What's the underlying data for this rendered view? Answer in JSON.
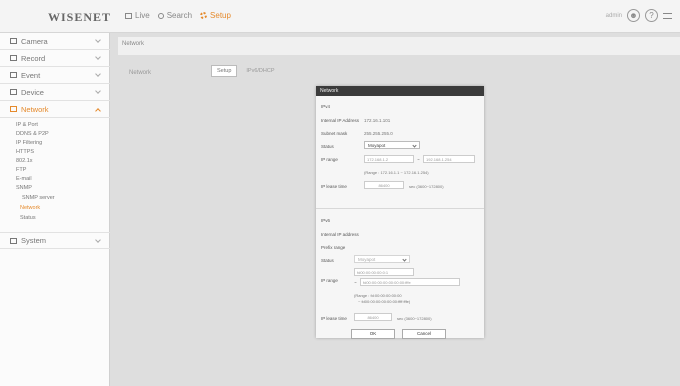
{
  "header": {
    "logo": "WISENET",
    "nav": [
      {
        "label": "Live",
        "icon": "monitor-icon"
      },
      {
        "label": "Search",
        "icon": "search-icon"
      },
      {
        "label": "Setup",
        "icon": "gear-icon"
      }
    ],
    "user": "admin",
    "help": "?",
    "accent": "#e58a2c"
  },
  "sidebar": {
    "items": [
      "Camera",
      "Record",
      "Event",
      "Device",
      "Network",
      "System"
    ],
    "network_sub": [
      "IP & Port",
      "DDNS & P2P",
      "IP Filtering",
      "HTTPS",
      "802.1x",
      "FTP",
      "E-mail",
      "SNMP",
      "SNMP server",
      "Network",
      "Status"
    ]
  },
  "breadcrumb": "Network",
  "main": {
    "label": "Network",
    "tabs": [
      "Setup",
      "IPv6/DHCP"
    ]
  },
  "dialog": {
    "title": "Network",
    "ipv4": {
      "section": "IPv4",
      "internal_ip_label": "Internal IP Address",
      "internal_ip": "172.16.1.101",
      "subnet_label": "Subnet mask",
      "subnet": "255.255.255.0",
      "status_label": "Status",
      "status": "Moyapot",
      "ip_range_label": "IP range",
      "range_start": "172.168.1.2",
      "range_end": "192.168.1.254",
      "range_note": "(Range : 172.16.1.1 ~ 172.16.1.254)",
      "lease_label": "IP lease time",
      "lease_value": "86400",
      "lease_unit": "sec (3600~172800)"
    },
    "ipv6": {
      "section": "IPv6",
      "internal_ip_label": "Internal IP address",
      "prefix_label": "Prefix range",
      "status_label": "Status",
      "status": "Moyapot",
      "ip_range_label": "IP range",
      "range_start": "fd00:00:00:00:0:1",
      "range_end": "fd00:00:00:00:00:00:00:fffe",
      "range_note": "(Range : fd:00:00:00:00:00",
      "range_note2": "~ fd00:00:00:00:00:00:ffff:fffe)",
      "lease_label": "IP lease time",
      "lease_value": "86400",
      "lease_unit": "sec (3600~172800)"
    },
    "ok": "OK",
    "cancel": "Cancel"
  }
}
